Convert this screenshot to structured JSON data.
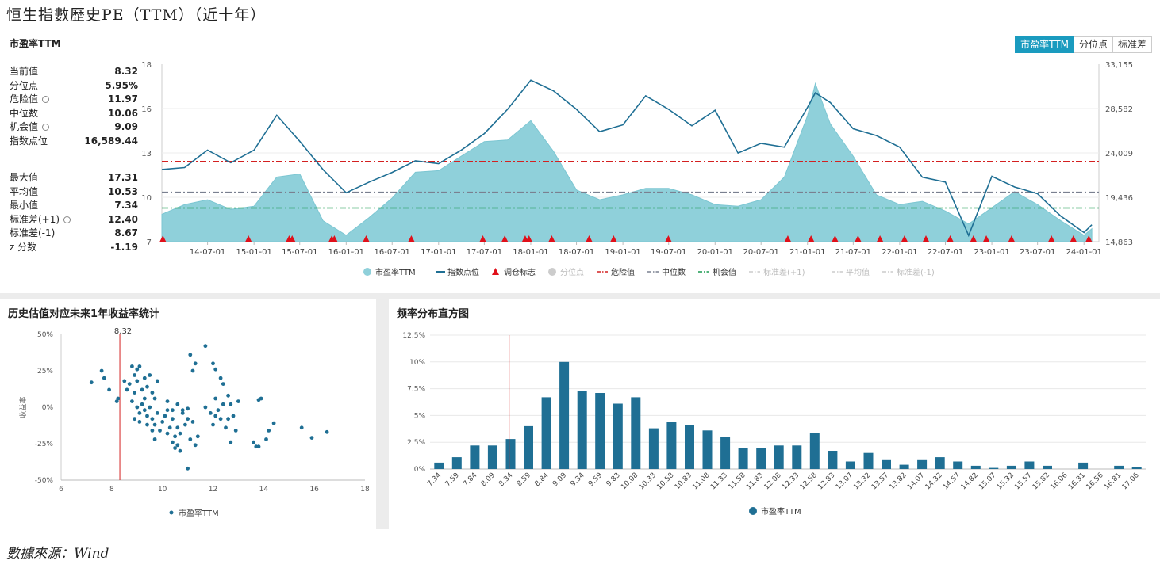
{
  "page_title": "恒生指數歷史PE（TTM）（近十年）",
  "source": "數據來源：Wind",
  "main_chart": {
    "panel_title": "市盈率TTM",
    "tabs": [
      {
        "label": "市盈率TTM",
        "active": true
      },
      {
        "label": "分位点",
        "active": false
      },
      {
        "label": "标准差",
        "active": false
      }
    ],
    "stats_top": [
      {
        "label": "当前值",
        "value": "8.32",
        "gear": false
      },
      {
        "label": "分位点",
        "value": "5.95%",
        "gear": false
      },
      {
        "label": "危险值",
        "value": "11.97",
        "gear": true
      },
      {
        "label": "中位数",
        "value": "10.06",
        "gear": false
      },
      {
        "label": "机会值",
        "value": "9.09",
        "gear": true
      },
      {
        "label": "指数点位",
        "value": "16,589.44",
        "gear": false
      }
    ],
    "stats_bottom": [
      {
        "label": "最大值",
        "value": "17.31",
        "gear": false
      },
      {
        "label": "平均值",
        "value": "10.53",
        "gear": false
      },
      {
        "label": "最小值",
        "value": "7.34",
        "gear": false
      },
      {
        "label": "标准差(+1)",
        "value": "12.40",
        "gear": true
      },
      {
        "label": "标准差(-1)",
        "value": "8.67",
        "gear": false
      },
      {
        "label": "z 分数",
        "value": "-1.19",
        "gear": false
      }
    ],
    "left_axis_ticks": [
      "18",
      "16",
      "13",
      "10",
      "7"
    ],
    "right_axis_ticks": [
      "33,155",
      "28,582",
      "24,009",
      "19,436",
      "14,863"
    ],
    "x_ticks": [
      "14-07-01",
      "15-01-01",
      "15-07-01",
      "16-01-01",
      "16-07-01",
      "17-01-01",
      "17-07-01",
      "18-01-01",
      "18-07-01",
      "19-01-01",
      "19-07-01",
      "20-01-01",
      "20-07-01",
      "21-01-01",
      "21-07-01",
      "22-01-01",
      "22-07-01",
      "23-01-01",
      "23-07-01",
      "24-01-01"
    ],
    "legend": [
      {
        "label": "市盈率TTM",
        "kind": "area",
        "color": "#8fd0da",
        "active": true
      },
      {
        "label": "指数点位",
        "kind": "line",
        "color": "#1f6f94",
        "active": true
      },
      {
        "label": "调仓标志",
        "kind": "triangle",
        "color": "#e0101a",
        "active": true
      },
      {
        "label": "分位点",
        "kind": "dot",
        "color": "#cccccc",
        "active": false
      },
      {
        "label": "危险值",
        "kind": "dashdot",
        "color": "#d42020",
        "active": true
      },
      {
        "label": "中位数",
        "kind": "dashdot",
        "color": "#7a8090",
        "active": true
      },
      {
        "label": "机会值",
        "kind": "dashdot",
        "color": "#1a9a50",
        "active": true
      },
      {
        "label": "标准差(+1)",
        "kind": "dashdot",
        "color": "#cccccc",
        "active": false
      },
      {
        "label": "平均值",
        "kind": "dashdot",
        "color": "#cccccc",
        "active": false
      },
      {
        "label": "标准差(-1)",
        "kind": "dashdot",
        "color": "#cccccc",
        "active": false
      }
    ]
  },
  "scatter_panel": {
    "title": "历史估值对应未来1年收益率统计",
    "ylabel": "收益率",
    "marker_label": "8.32",
    "legend": "市盈率TTM"
  },
  "hist_panel": {
    "title": "频率分布直方图",
    "legend": "市盈率TTM"
  },
  "chart_data": [
    {
      "type": "area",
      "id": "pe-history",
      "x_start": "2014-01-01",
      "x_end": "2024-02-29",
      "pe_axis": [
        7,
        18
      ],
      "index_axis": [
        14863,
        33155
      ],
      "reference_lines": {
        "danger": 11.97,
        "median": 10.06,
        "opportunity": 9.09
      },
      "pe_series": {
        "name": "市盈率TTM",
        "x": [
          "2014-01",
          "2014-04",
          "2014-07",
          "2014-10",
          "2015-01",
          "2015-04",
          "2015-07",
          "2015-10",
          "2016-01",
          "2016-04",
          "2016-07",
          "2016-10",
          "2017-01",
          "2017-04",
          "2017-07",
          "2017-10",
          "2018-01",
          "2018-04",
          "2018-07",
          "2018-10",
          "2019-01",
          "2019-04",
          "2019-07",
          "2019-10",
          "2020-01",
          "2020-04",
          "2020-07",
          "2020-10",
          "2021-01",
          "2021-02",
          "2021-04",
          "2021-07",
          "2021-10",
          "2022-01",
          "2022-04",
          "2022-07",
          "2022-10",
          "2023-01",
          "2023-04",
          "2023-07",
          "2023-10",
          "2024-01",
          "2024-02"
        ],
        "y": [
          8.7,
          9.3,
          9.6,
          9.0,
          9.2,
          11.0,
          11.2,
          8.3,
          7.4,
          8.5,
          9.7,
          11.3,
          11.4,
          12.3,
          13.2,
          13.3,
          14.5,
          12.6,
          10.2,
          9.6,
          9.9,
          10.3,
          10.3,
          9.9,
          9.3,
          9.2,
          9.6,
          11.0,
          14.8,
          16.8,
          14.3,
          12.3,
          9.9,
          9.3,
          9.5,
          8.9,
          8.1,
          9.1,
          10.1,
          9.3,
          8.3,
          7.4,
          7.8
        ]
      },
      "index_series": {
        "name": "指数点位",
        "x": [
          "2014-01",
          "2014-04",
          "2014-07",
          "2014-10",
          "2015-01",
          "2015-04",
          "2015-07",
          "2015-10",
          "2016-01",
          "2016-04",
          "2016-07",
          "2016-10",
          "2017-01",
          "2017-04",
          "2017-07",
          "2017-10",
          "2018-01",
          "2018-04",
          "2018-07",
          "2018-10",
          "2019-01",
          "2019-04",
          "2019-07",
          "2019-10",
          "2020-01",
          "2020-04",
          "2020-07",
          "2020-10",
          "2021-01",
          "2021-02",
          "2021-04",
          "2021-07",
          "2021-10",
          "2022-01",
          "2022-04",
          "2022-07",
          "2022-10",
          "2023-01",
          "2023-04",
          "2023-07",
          "2023-10",
          "2024-01",
          "2024-02"
        ],
        "y": [
          22300,
          22500,
          24300,
          23000,
          24300,
          27900,
          25200,
          22300,
          19900,
          21000,
          22000,
          23200,
          22900,
          24300,
          26000,
          28500,
          31500,
          30400,
          28500,
          26200,
          26900,
          29900,
          28500,
          26800,
          28400,
          24000,
          25000,
          24600,
          28700,
          30200,
          29200,
          26500,
          25800,
          24600,
          21500,
          21000,
          15500,
          21600,
          20500,
          19800,
          17500,
          15800,
          16600
        ]
      },
      "rebalance_markers": {
        "name": "调仓标志",
        "x": [
          "2014-01-05",
          "2014-12-10",
          "2015-05-20",
          "2015-06-01",
          "2015-11-05",
          "2015-11-15",
          "2016-03-20",
          "2016-09-15",
          "2017-06-25",
          "2017-09-20",
          "2017-12-10",
          "2017-12-25",
          "2018-03-25",
          "2018-08-20",
          "2018-11-25",
          "2019-06-30",
          "2020-10-15",
          "2021-01-15",
          "2021-04-20",
          "2021-07-20",
          "2021-10-15",
          "2022-01-20",
          "2022-04-15",
          "2022-07-20",
          "2022-10-20",
          "2022-12-10",
          "2023-03-20",
          "2023-08-25",
          "2023-11-20",
          "2024-01-20"
        ]
      }
    },
    {
      "type": "scatter",
      "id": "pe-vs-return",
      "xlim": [
        6,
        18
      ],
      "ylim": [
        -50,
        50
      ],
      "xlabel": "",
      "ylabel": "收益率",
      "x_ticks": [
        6,
        8,
        10,
        12,
        14,
        16,
        18
      ],
      "y_ticks": [
        "50%",
        "25%",
        "0%",
        "-25%",
        "-50%"
      ],
      "vline": 8.32,
      "series": [
        {
          "name": "市盈率TTM",
          "points": [
            [
              7.2,
              17
            ],
            [
              7.6,
              25
            ],
            [
              7.7,
              20
            ],
            [
              7.9,
              12
            ],
            [
              8.2,
              4
            ],
            [
              8.25,
              6
            ],
            [
              8.6,
              12
            ],
            [
              8.8,
              28
            ],
            [
              8.7,
              16
            ],
            [
              8.9,
              22
            ],
            [
              9.0,
              26
            ],
            [
              9.1,
              28
            ],
            [
              9.0,
              18
            ],
            [
              9.2,
              12
            ],
            [
              9.3,
              20
            ],
            [
              9.4,
              14
            ],
            [
              9.5,
              22
            ],
            [
              9.6,
              10
            ],
            [
              9.7,
              6
            ],
            [
              9.8,
              18
            ],
            [
              8.9,
              10
            ],
            [
              8.8,
              4
            ],
            [
              9.0,
              0
            ],
            [
              9.1,
              -4
            ],
            [
              9.2,
              2
            ],
            [
              9.3,
              -2
            ],
            [
              9.4,
              -6
            ],
            [
              9.5,
              0
            ],
            [
              9.6,
              -8
            ],
            [
              9.7,
              -12
            ],
            [
              9.8,
              -4
            ],
            [
              9.9,
              -16
            ],
            [
              10.0,
              -10
            ],
            [
              10.1,
              -6
            ],
            [
              10.2,
              -2
            ],
            [
              10.3,
              -14
            ],
            [
              10.4,
              -8
            ],
            [
              10.5,
              -20
            ],
            [
              10.6,
              -26
            ],
            [
              10.7,
              -18
            ],
            [
              10.8,
              -4
            ],
            [
              10.9,
              -12
            ],
            [
              11.0,
              -8
            ],
            [
              11.1,
              -22
            ],
            [
              10.2,
              4
            ],
            [
              10.4,
              -2
            ],
            [
              10.6,
              2
            ],
            [
              10.8,
              -2
            ],
            [
              11.0,
              -1
            ],
            [
              9.1,
              -10
            ],
            [
              9.4,
              -12
            ],
            [
              9.7,
              -22
            ],
            [
              10.5,
              -28
            ],
            [
              10.7,
              -30
            ],
            [
              11.0,
              -42
            ],
            [
              11.3,
              -26
            ],
            [
              11.1,
              36
            ],
            [
              11.3,
              30
            ],
            [
              11.2,
              25
            ],
            [
              11.7,
              42
            ],
            [
              12.0,
              30
            ],
            [
              12.1,
              26
            ],
            [
              12.3,
              20
            ],
            [
              12.4,
              16
            ],
            [
              12.1,
              6
            ],
            [
              12.2,
              -2
            ],
            [
              12.3,
              -8
            ],
            [
              12.4,
              2
            ],
            [
              12.0,
              -12
            ],
            [
              12.5,
              -14
            ],
            [
              12.6,
              -8
            ],
            [
              12.8,
              -6
            ],
            [
              12.9,
              -16
            ],
            [
              13.0,
              4
            ],
            [
              12.6,
              8
            ],
            [
              12.7,
              2
            ],
            [
              11.7,
              0
            ],
            [
              11.9,
              -4
            ],
            [
              12.1,
              -6
            ],
            [
              13.6,
              -24
            ],
            [
              13.7,
              -27
            ],
            [
              13.8,
              -27
            ],
            [
              14.1,
              -22
            ],
            [
              14.2,
              -16
            ],
            [
              14.4,
              -11
            ],
            [
              13.8,
              5
            ],
            [
              13.9,
              6
            ],
            [
              15.5,
              -14
            ],
            [
              15.9,
              -21
            ],
            [
              16.5,
              -17
            ],
            [
              8.5,
              18
            ],
            [
              8.9,
              -8
            ],
            [
              9.3,
              6
            ],
            [
              9.6,
              -16
            ],
            [
              10.2,
              -18
            ],
            [
              10.4,
              -24
            ],
            [
              10.6,
              -14
            ],
            [
              11.2,
              -10
            ],
            [
              11.4,
              -20
            ],
            [
              12.7,
              -24
            ]
          ]
        }
      ]
    },
    {
      "type": "bar",
      "id": "pe-histogram",
      "categories": [
        "7.34",
        "7.59",
        "7.84",
        "8.09",
        "8.34",
        "8.59",
        "8.84",
        "9.09",
        "9.34",
        "9.59",
        "9.83",
        "10.08",
        "10.33",
        "10.58",
        "10.83",
        "11.08",
        "11.33",
        "11.58",
        "11.83",
        "12.08",
        "12.33",
        "12.58",
        "12.83",
        "13.07",
        "13.32",
        "13.57",
        "13.82",
        "14.07",
        "14.32",
        "14.57",
        "14.82",
        "15.07",
        "15.32",
        "15.57",
        "15.82",
        "16.06",
        "16.31",
        "16.56",
        "16.81",
        "17.06"
      ],
      "ylim": [
        0,
        12.5
      ],
      "y_ticks": [
        "12.5%",
        "10%",
        "7.5%",
        "5%",
        "2.5%",
        "0%"
      ],
      "vline": 8.32,
      "series": [
        {
          "name": "市盈率TTM",
          "values": [
            0.6,
            1.1,
            2.2,
            2.2,
            2.8,
            4.0,
            6.7,
            10.0,
            7.3,
            7.1,
            6.1,
            6.7,
            3.8,
            4.4,
            4.1,
            3.6,
            3.0,
            2.0,
            2.0,
            2.2,
            2.2,
            3.4,
            1.7,
            0.7,
            1.5,
            0.9,
            0.4,
            0.9,
            1.1,
            0.7,
            0.3,
            0.1,
            0.3,
            0.7,
            0.3,
            0.0,
            0.6,
            0.0,
            0.3,
            0.2
          ]
        }
      ]
    }
  ]
}
